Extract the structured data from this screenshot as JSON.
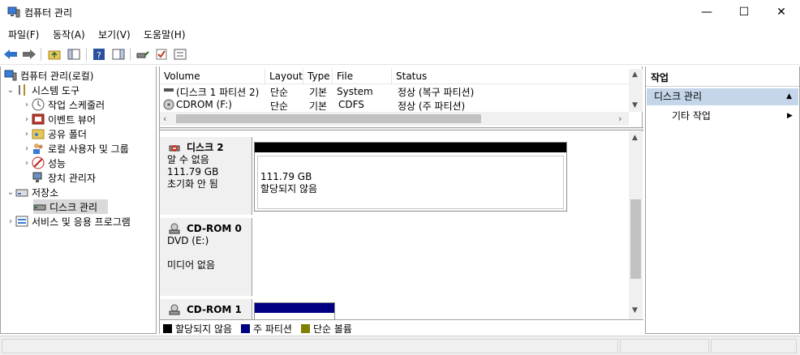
{
  "window": {
    "title": "컴퓨터 관리",
    "minimize": "—",
    "maximize": "☐",
    "close": "✕"
  },
  "menu": [
    "파일(F)",
    "동작(A)",
    "보기(V)",
    "도움말(H)"
  ],
  "tree": {
    "root": "컴퓨터 관리(로컬)",
    "system_tools": "시스템 도구",
    "task_scheduler": "작업 스케줄러",
    "event_viewer": "이벤트 뷰어",
    "shared_folders": "공유 폴더",
    "local_users": "로컬 사용자 및 그룹",
    "performance": "성능",
    "device_manager": "장치 관리자",
    "storage": "저장소",
    "disk_management": "디스크 관리",
    "services_apps": "서비스 및 응용 프로그램"
  },
  "volumes": {
    "headers": [
      "Volume",
      "Layout",
      "Type",
      "File System",
      "Status"
    ],
    "rows": [
      {
        "volume": "(디스크 1 파티션 2)",
        "layout": "단순",
        "type": "기본",
        "fs": "",
        "status": "정상 (복구 파티션)"
      },
      {
        "volume": "CDROM (F:)",
        "layout": "단순",
        "type": "기본",
        "fs": "CDFS",
        "status": "정상 (주 파티션)"
      }
    ]
  },
  "disks": [
    {
      "name": "디스크 2",
      "line1": "알 수 없음",
      "line2": "111.79 GB",
      "line3": "초기화 안 됨",
      "part_size": "111.79 GB",
      "part_status": "할당되지 않음"
    },
    {
      "name": "CD-ROM 0",
      "line1": "DVD (E:)",
      "line2": "",
      "line3": "미디어 없음"
    },
    {
      "name": "CD-ROM 1"
    }
  ],
  "legend": [
    {
      "label": "할당되지 않음",
      "color": "#000000"
    },
    {
      "label": "주 파티션",
      "color": "#000080"
    },
    {
      "label": "단순 볼륨",
      "color": "#808000"
    }
  ],
  "actions": {
    "header": "작업",
    "section": "디스크 관리",
    "more": "기타 작업"
  }
}
